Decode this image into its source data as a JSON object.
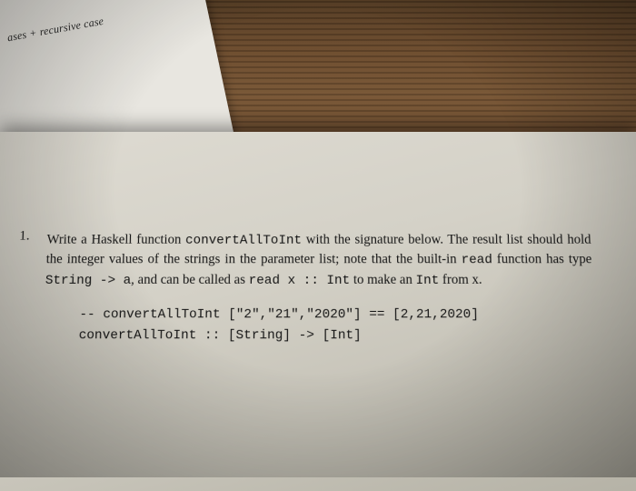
{
  "back_paper": {
    "corner_text": "ases + recursive case"
  },
  "main_paper": {
    "question_marker": "1.",
    "prompt_parts": {
      "p1": "Write a Haskell function ",
      "fn_name": "convertAllToInt",
      "p2": " with the signature below. The result list should hold the integer values of the strings in the parameter list; note that the built-in ",
      "read_fn": "read",
      "p3": " function has type ",
      "read_type": "String -> a",
      "p4": ", and can be called as ",
      "read_call": "read x :: Int",
      "p5": " to make an ",
      "int_word": "Int",
      "p6": " from x."
    },
    "code": {
      "comment": "-- convertAllToInt [\"2\",\"21\",\"2020\"] == [2,21,2020]",
      "signature": "convertAllToInt :: [String] -> [Int]"
    }
  }
}
